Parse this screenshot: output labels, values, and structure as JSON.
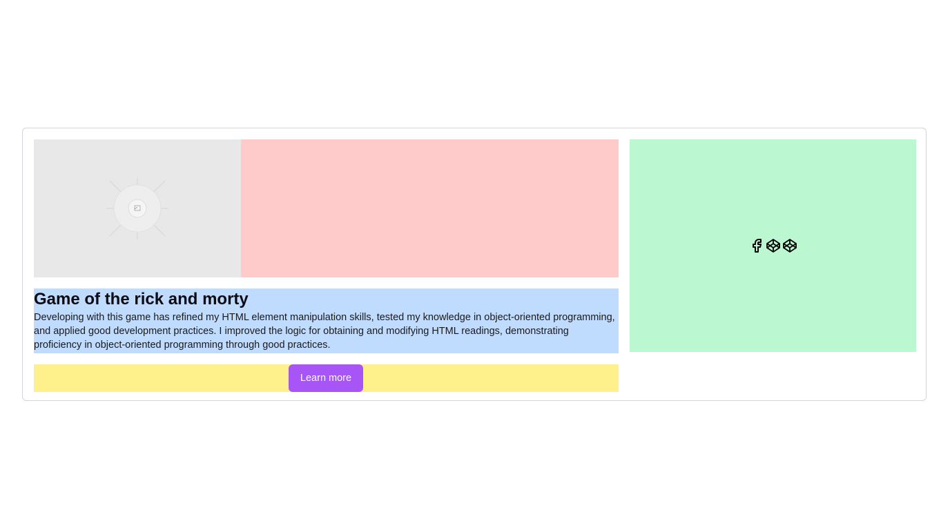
{
  "project": {
    "title": "Game of the rick and morty",
    "description": "Developing with this game has refined my HTML element manipulation skills, tested my knowledge in object-oriented programming, and applied good development practices. I improved the logic for obtaining and modifying HTML readings, demonstrating proficiency in object-oriented programming through good practices.",
    "learn_more_label": "Learn more",
    "image_icon": "image-placeholder-icon"
  },
  "social": {
    "icons": [
      "facebook-icon",
      "codepen-icon",
      "codepen-icon"
    ]
  },
  "colors": {
    "image_placeholder": "#e8e8e8",
    "media_panel": "#fecaca",
    "text_panel": "#bfdbfe",
    "action_panel": "#fef08a",
    "button": "#a855f7",
    "side_panel": "#bbf7d0"
  }
}
